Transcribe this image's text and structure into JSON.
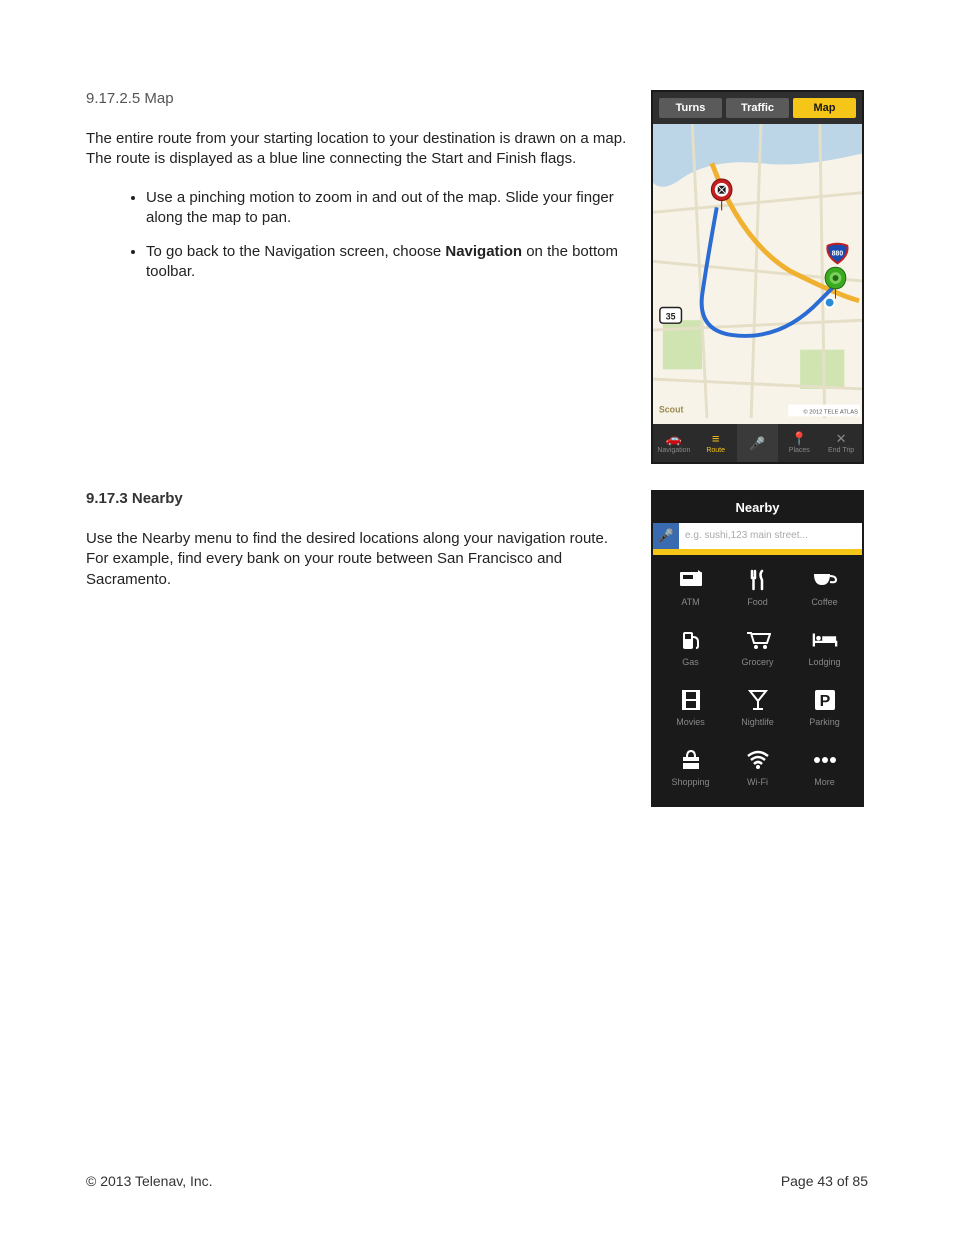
{
  "sectionMap": {
    "heading": "9.17.2.5 Map",
    "p1": "The entire route from your starting location to your destination is drawn on a map. The route is displayed as a blue line connecting the Start and Finish flags.",
    "b1": "Use a pinching motion to zoom in and out of the map. Slide your finger along the map to pan.",
    "b2a": "To go back to the Navigation screen, choose ",
    "b2bold": "Navigation",
    "b2b": " on the bottom toolbar."
  },
  "mapScreen": {
    "tabs": {
      "turns": "Turns",
      "traffic": "Traffic",
      "map": "Map"
    },
    "routeBadge": "35",
    "interstate": "880",
    "logo": "Scout",
    "attribution": "© 2012 TELE ATLAS",
    "toolbar": {
      "nav": "Navigation",
      "route": "Route",
      "mic": "",
      "places": "Places",
      "end": "End Trip"
    }
  },
  "sectionNearby": {
    "heading": "9.17.3 Nearby",
    "p1": "Use the Nearby menu to find the desired locations along your navigation route. For example, find every bank on your route between San Francisco and Sacramento."
  },
  "nearbyScreen": {
    "title": "Nearby",
    "placeholder": "e.g. sushi,123 main street...",
    "cats": {
      "atm": "ATM",
      "food": "Food",
      "coffee": "Coffee",
      "gas": "Gas",
      "grocery": "Grocery",
      "lodging": "Lodging",
      "movies": "Movies",
      "nightlife": "Nightlife",
      "parking": "Parking",
      "shopping": "Shopping",
      "wifi": "Wi-Fi",
      "more": "More"
    }
  },
  "footer": {
    "copyright": "© 2013 Telenav, Inc.",
    "page": "Page 43 of 85"
  }
}
